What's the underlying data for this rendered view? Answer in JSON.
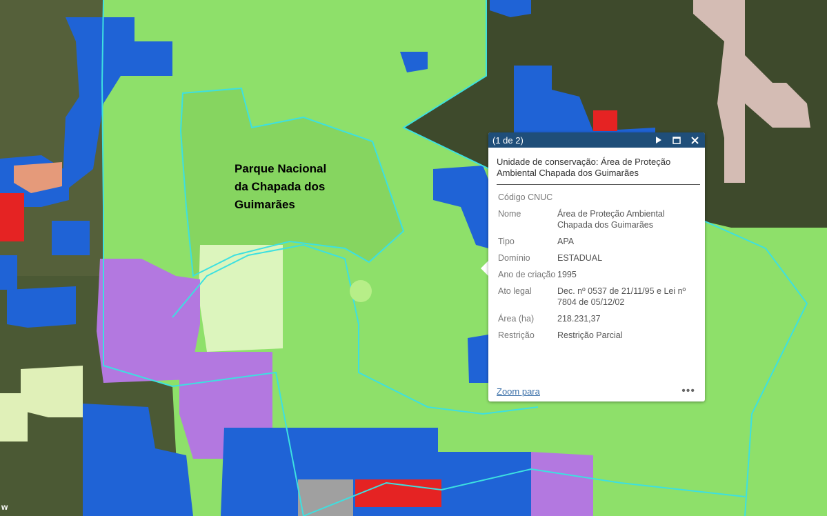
{
  "map": {
    "label_lines": [
      "Parque Nacional",
      "da Chapada dos",
      "Guimarães"
    ],
    "corner_text": "w",
    "colors": {
      "terrain": "#4d5a36",
      "apa_green": "#8ee06a",
      "park_green": "#86d85f",
      "blue": "#1e64d8",
      "purple": "#b07ae0",
      "pale_green": "#d8f2b8",
      "pink_gray": "#d6bdb5",
      "red": "#e82020",
      "outline_cyan": "#3de0e0"
    }
  },
  "popup": {
    "pager": "(1 de 2)",
    "title": "Unidade de conservação: Área de Proteção Ambiental Chapada dos Guimarães",
    "attributes": [
      {
        "key": "Código CNUC",
        "value": ""
      },
      {
        "key": "Nome",
        "value": "Área de Proteção Ambiental Chapada dos Guimarães"
      },
      {
        "key": "Tipo",
        "value": "APA"
      },
      {
        "key": "Domínio",
        "value": "ESTADUAL"
      },
      {
        "key": "Ano de criação",
        "value": "1995"
      },
      {
        "key": "Ato legal",
        "value": "Dec. nº 0537 de 21/11/95 e Lei nº 7804 de 05/12/02"
      },
      {
        "key": "Área (ha)",
        "value": "218.231,37"
      },
      {
        "key": "Restrição",
        "value": "Restrição Parcial"
      }
    ],
    "zoom_label": "Zoom para",
    "more_label": "•••"
  }
}
